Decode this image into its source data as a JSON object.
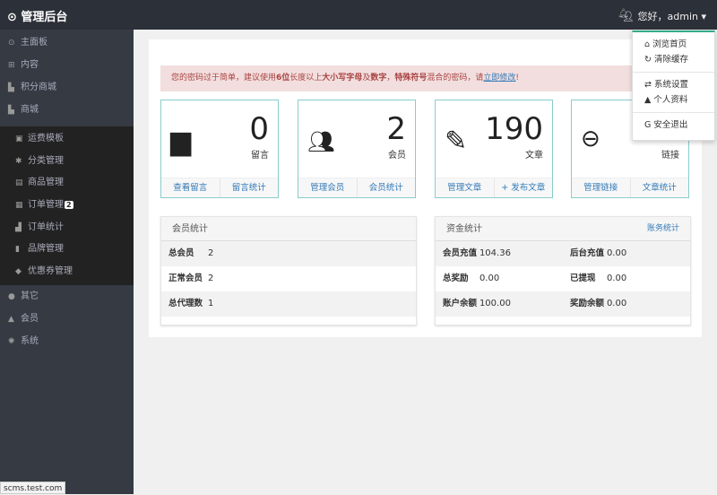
{
  "header": {
    "brand": "管理后台",
    "user": "您好，admin"
  },
  "sidebar": {
    "items": [
      {
        "icon": "dashboard-icon",
        "label": "主面板"
      },
      {
        "icon": "grid-icon",
        "label": "内容"
      },
      {
        "icon": "cart-icon",
        "label": "积分商城"
      },
      {
        "icon": "cart-icon",
        "label": "商城"
      }
    ],
    "sub": [
      {
        "icon": "template-icon",
        "label": "运费模板"
      },
      {
        "icon": "asterisk-icon",
        "label": "分类管理"
      },
      {
        "icon": "gift-icon",
        "label": "商品管理"
      },
      {
        "icon": "order-icon",
        "label": "订单管理",
        "badge": "2"
      },
      {
        "icon": "chart-icon",
        "label": "订单统计"
      },
      {
        "icon": "bookmark-icon",
        "label": "品牌管理"
      },
      {
        "icon": "tag-icon",
        "label": "优惠券管理"
      }
    ],
    "bottom": [
      {
        "icon": "box-icon",
        "label": "其它"
      },
      {
        "icon": "user-icon",
        "label": "会员"
      },
      {
        "icon": "gear-icon",
        "label": "系统"
      }
    ]
  },
  "alert": {
    "pre": "您的密码过于简单，建议使用",
    "b1": "6位",
    "mid1": "长度以上",
    "b2": "大小写字母",
    "mid2": "及",
    "b3": "数字",
    "mid3": "，",
    "b4": "特殊符号",
    "mid4": "混合的密码，请",
    "link": "立即修改",
    "post": "!"
  },
  "cards": [
    {
      "icon": "comments-icon",
      "value": "0",
      "label": "留言",
      "links": [
        "查看留言",
        "留言统计"
      ]
    },
    {
      "icon": "users-icon",
      "value": "2",
      "label": "会员",
      "links": [
        "管理会员",
        "会员统计"
      ]
    },
    {
      "icon": "pencil-icon",
      "value": "190",
      "label": "文章",
      "links": [
        "管理文章",
        "+ 发布文章"
      ]
    },
    {
      "icon": "link-icon",
      "value": "",
      "label": "链接",
      "links": [
        "管理链接",
        "文章统计"
      ]
    }
  ],
  "members": {
    "title": "会员统计",
    "rows": [
      [
        "总会员",
        "2"
      ],
      [
        "正常会员",
        "2"
      ],
      [
        "总代理数",
        "1"
      ]
    ]
  },
  "funds": {
    "title": "资金统计",
    "link": "账务统计",
    "rows": [
      [
        "会员充值",
        "104.36",
        "后台充值",
        "0.00"
      ],
      [
        "总奖励",
        "0.00",
        "已提现",
        "0.00"
      ],
      [
        "账户余额",
        "100.00",
        "奖励余额",
        "0.00"
      ]
    ]
  },
  "dropdown": [
    "浏览首页",
    "清除缓存",
    "系统设置",
    "个人资料",
    "安全退出"
  ],
  "status": "scms.test.com"
}
